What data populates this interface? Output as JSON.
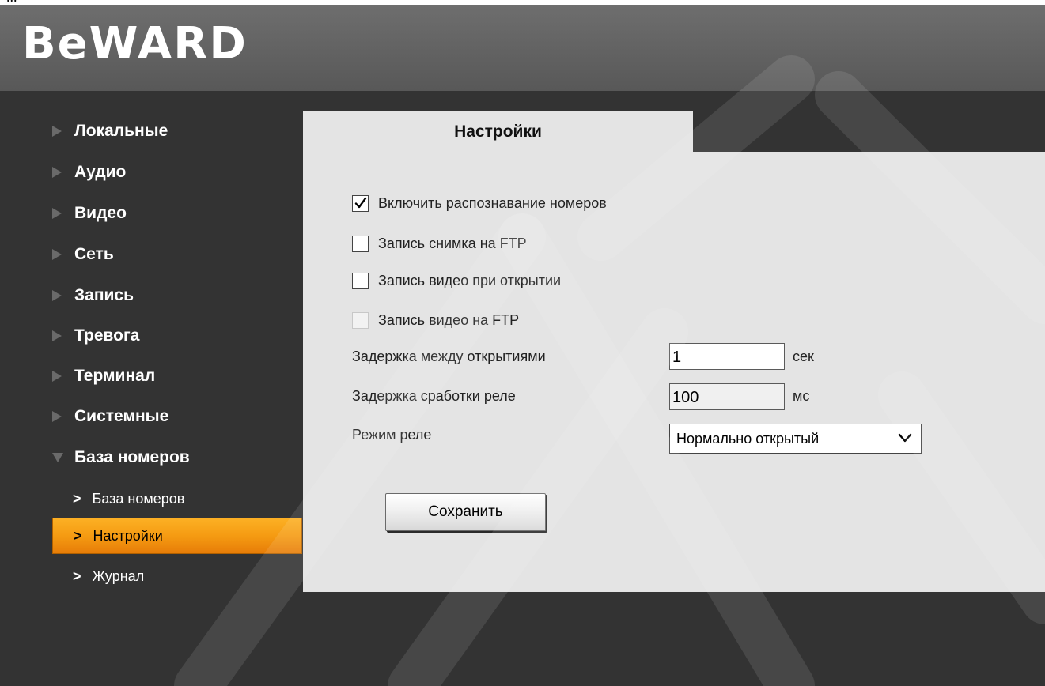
{
  "top_text": "...",
  "logo": {
    "text": "BeWARD"
  },
  "sidebar": {
    "items": [
      {
        "label": "Локальные",
        "expanded": false
      },
      {
        "label": "Аудио",
        "expanded": false
      },
      {
        "label": "Видео",
        "expanded": false
      },
      {
        "label": "Сеть",
        "expanded": false
      },
      {
        "label": "Запись",
        "expanded": false
      },
      {
        "label": "Тревога",
        "expanded": false
      },
      {
        "label": "Терминал",
        "expanded": false
      },
      {
        "label": "Системные",
        "expanded": false
      },
      {
        "label": "База номеров",
        "expanded": true
      }
    ],
    "subitems": [
      {
        "label": "База номеров",
        "active": false
      },
      {
        "label": "Настройки",
        "active": true
      },
      {
        "label": "Журнал",
        "active": false
      }
    ]
  },
  "tab": {
    "label": "Настройки"
  },
  "settings": {
    "checkboxes": [
      {
        "label": "Включить распознавание номеров",
        "checked": true,
        "enabled": true
      },
      {
        "label": "Запись снимка на FTP",
        "checked": false,
        "enabled": true
      },
      {
        "label": "Запись видео при открытии",
        "checked": false,
        "enabled": true
      },
      {
        "label": "Запись видео на FTP",
        "checked": false,
        "enabled": false
      }
    ],
    "open_delay": {
      "label": "Задержка между открытиями",
      "value": "1",
      "unit": "сек"
    },
    "relay_delay": {
      "label": "Задержка сработки реле",
      "value": "100",
      "unit": "мс"
    },
    "relay_mode": {
      "label": "Режим реле",
      "value": "Нормально открытый"
    },
    "save_label": "Сохранить"
  },
  "colors": {
    "header": "#626262",
    "background": "#333333",
    "panel": "#e4e4e4",
    "active_item": "#f59b12"
  },
  "icons": {
    "checkmark": "checkmark-icon",
    "chevron": "chevron-down-icon",
    "arrow": "triangle-right-icon"
  }
}
